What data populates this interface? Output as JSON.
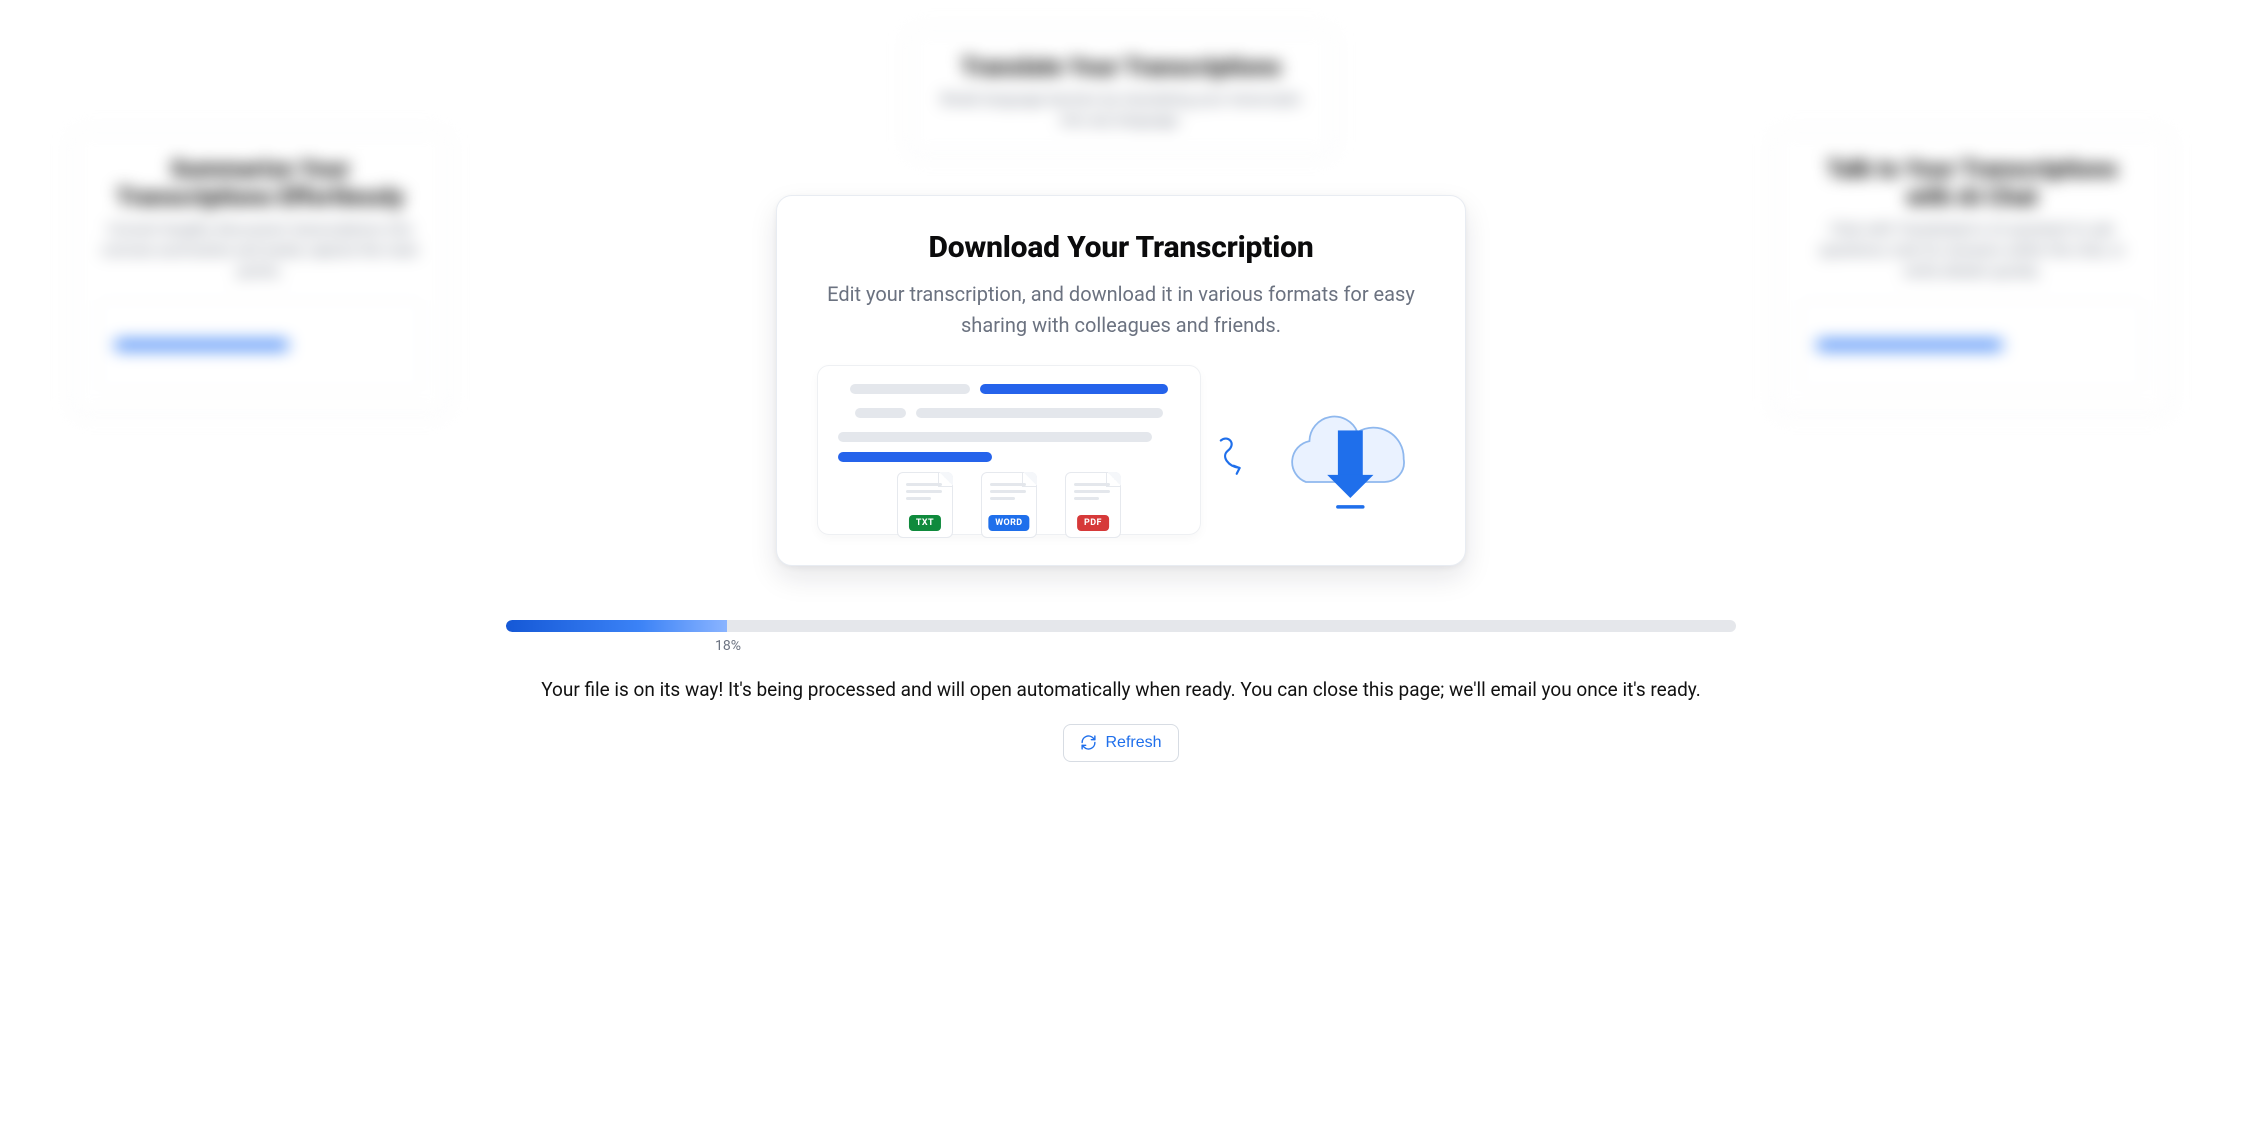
{
  "background_cards": {
    "left": {
      "title": "Summarize Your Transcriptions Effortlessly",
      "desc": "Convert lengthy discussion transcriptions into concise summaries and easily capture the main points."
    },
    "top": {
      "title": "Translate Your Transcriptions",
      "desc": "Break language barriers by translating your transcripts into any language."
    },
    "right": {
      "title": "Talk to Your Transcriptions with AI Chat",
      "desc": "Chat with Transkriptor's AI assistant to ask questions, look for answers within the chat, or verify details quickly."
    }
  },
  "card": {
    "title": "Download Your Transcription",
    "subtitle": "Edit your transcription, and download it in various formats for easy sharing with colleagues and friends.",
    "formats": [
      "TXT",
      "WORD",
      "PDF"
    ],
    "format_colors": {
      "TXT": "#0f8a3c",
      "WORD": "#1f6feb",
      "PDF": "#d63939"
    }
  },
  "progress": {
    "percent": 18,
    "label": "18%"
  },
  "status_message": "Your file is on its way! It's being processed and will open automatically when ready. You can close this page; we'll email you once it's ready.",
  "refresh": {
    "label": "Refresh"
  },
  "colors": {
    "accent": "#1f6feb",
    "progress_start": "#1558d6",
    "progress_end": "#8ab4ff",
    "track": "#e5e7eb",
    "muted_text": "#6b7280"
  }
}
